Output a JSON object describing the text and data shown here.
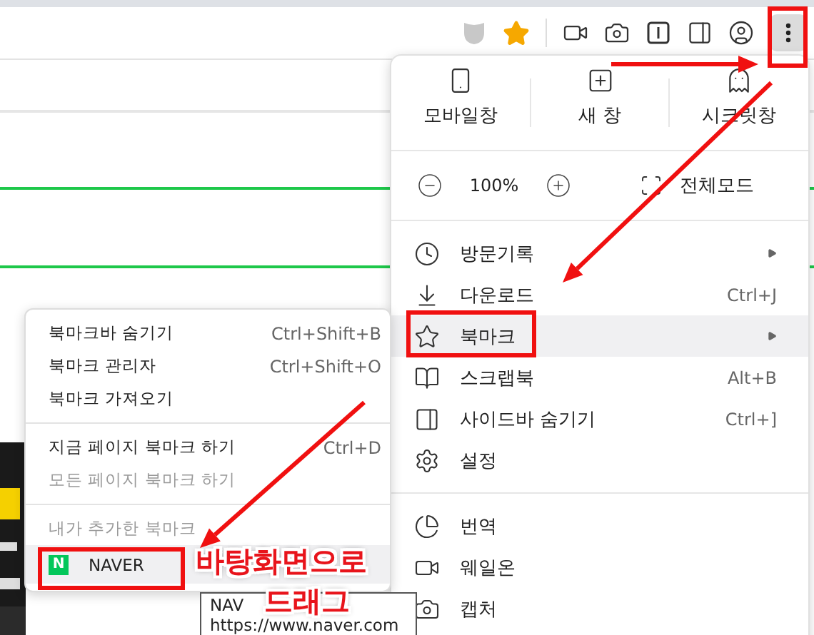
{
  "main_menu": {
    "window_buttons": [
      {
        "label": "모바일창"
      },
      {
        "label": "새 창"
      },
      {
        "label": "시크릿창"
      }
    ],
    "zoom_level": "100%",
    "fullscreen": "전체모드",
    "sections": [
      [
        {
          "label": "방문기록",
          "submenu": true,
          "selected": false
        },
        {
          "label": "다운로드",
          "shortcut": "Ctrl+J",
          "selected": false
        },
        {
          "label": "북마크",
          "submenu": true,
          "selected": true
        },
        {
          "label": "스크랩북",
          "shortcut": "Alt+B",
          "selected": false
        },
        {
          "label": "사이드바 숨기기",
          "shortcut": "Ctrl+]",
          "selected": false
        },
        {
          "label": "설정",
          "selected": false
        }
      ],
      [
        {
          "label": "번역",
          "selected": false
        },
        {
          "label": "웨일온",
          "selected": false
        },
        {
          "label": "캡처",
          "selected": false
        }
      ]
    ]
  },
  "bookmark_menu": {
    "sections": [
      [
        {
          "kind": "item",
          "label": "북마크바 숨기기",
          "shortcut": "Ctrl+Shift+B",
          "disabled": false,
          "selected": false
        },
        {
          "kind": "item",
          "label": "북마크 관리자",
          "shortcut": "Ctrl+Shift+O",
          "disabled": false,
          "selected": false
        },
        {
          "kind": "item",
          "label": "북마크 가져오기",
          "disabled": false,
          "selected": false
        }
      ],
      [
        {
          "kind": "item",
          "label": "지금 페이지 북마크 하기",
          "shortcut": "Ctrl+D",
          "disabled": false,
          "selected": false
        },
        {
          "kind": "item",
          "label": "모든 페이지 북마크 하기",
          "disabled": true,
          "selected": false
        }
      ],
      [
        {
          "kind": "header",
          "label": "내가 추가한 북마크"
        },
        {
          "kind": "bookmark",
          "label": "NAVER",
          "favicon": "N",
          "selected": true
        }
      ]
    ]
  },
  "tooltip": {
    "title": "NAV",
    "url": "https://www.naver.com"
  },
  "annotation": {
    "caption_lines": [
      "바탕화면으로",
      "드래그"
    ]
  }
}
